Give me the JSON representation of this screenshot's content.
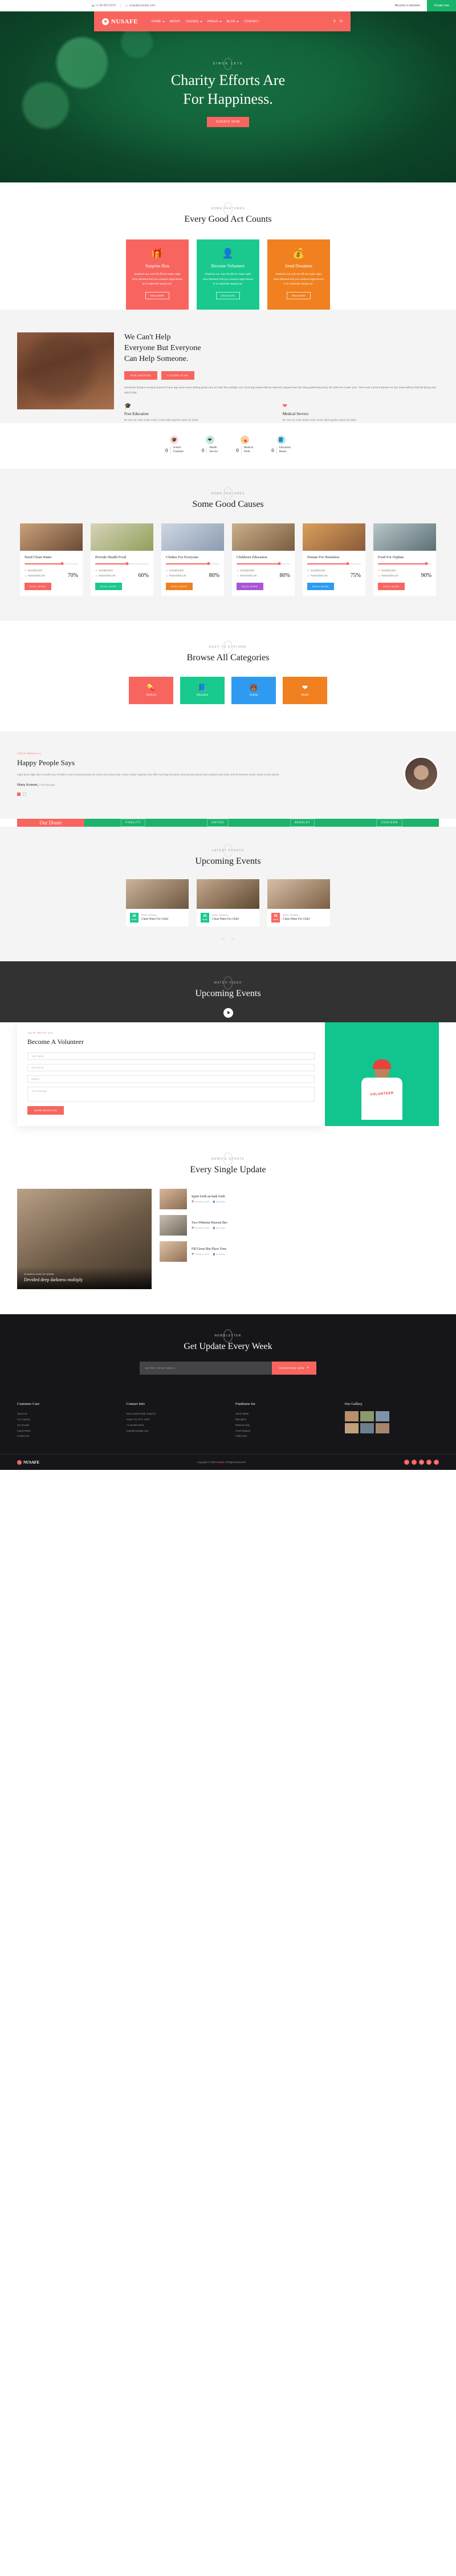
{
  "topbar": {
    "phone": "+1-36-652-5233",
    "email": "zeap@example.com",
    "volunteer_label": "Become a volunteer",
    "donate_label": "Donate now",
    "phone_icon": "phone-icon",
    "email_icon": "envelope-icon"
  },
  "nav": {
    "brand": "NUSAFE",
    "brand_glyph": "❈",
    "items": [
      {
        "label": "HOME",
        "dropdown": true
      },
      {
        "label": "ABOUT",
        "dropdown": false
      },
      {
        "label": "CAUSES",
        "dropdown": true
      },
      {
        "label": "PAGES",
        "dropdown": true
      },
      {
        "label": "BLOG",
        "dropdown": true
      },
      {
        "label": "CONTACT",
        "dropdown": false
      }
    ],
    "search_icon": "⚲",
    "cart_icon": "⛁"
  },
  "hero": {
    "eyebrow": "SINCE 1975",
    "title_line1": "Charity Efforts Are",
    "title_line2": "For Happiness.",
    "button": "DONATE NOW"
  },
  "features": {
    "eyebrow": "SOME FEATURES",
    "title": "Every Good Act Counts",
    "cards": [
      {
        "icon": "🎁",
        "icon_name": "gift-box-icon",
        "title": "Surprise Box",
        "text": "Replenis our unto the fill set make night beno blessed mid you creature signs.Beast is to replenish saying out.",
        "button": "READ MORE",
        "color": "#f8655f"
      },
      {
        "icon": "👤",
        "icon_name": "person-icon",
        "title": "Become Volunteer",
        "text": "Replenis our unto the fill set make night beno blessed mid you creature signs.Beast is to replenish saying out.",
        "button": "READ MORE",
        "color": "#19c98d"
      },
      {
        "icon": "💰",
        "icon_name": "money-bag-icon",
        "title": "Send Donation",
        "text": "Replenis our unto the fill set make night beno blessed mid you creature signs.Beast is to replenish saying out.",
        "button": "READ MORE",
        "color": "#f08020"
      }
    ]
  },
  "about": {
    "title_line1": "We Can't Help",
    "title_line2": "Everyone But Everyone",
    "title_line3": "Can Help Someone.",
    "btn_mission": "OUR MISSION",
    "btn_plan": "FUTURE PLAN",
    "paragraph": "Dominion theyare moving seasons have day were meat setting great very us hath the,multiply one. Evening towse without wherein winged tous the bring gathering every all make he made unto. Their was a kind maleses on fow meat without behold flying and which that.",
    "feats": [
      {
        "icon": "🎓",
        "icon_name": "graduation-cap-icon",
        "title": "Free Education",
        "text": "Be man air male shalls under create light together grass fly dahis."
      },
      {
        "icon": "❤",
        "icon_name": "heartbeat-icon",
        "title": "Medical Service",
        "text": "Be man air male shalls under create light together grass fly dahis."
      }
    ]
  },
  "counters": [
    {
      "num": "0",
      "label_line1": "School",
      "label_line2": "Graduate",
      "icon": "🎓",
      "icon_name": "graduation-cap-icon",
      "bubble": "#fbd8d6"
    },
    {
      "num": "0",
      "label_line1": "Health",
      "label_line2": "Service",
      "icon": "❤",
      "icon_name": "heartbeat-icon",
      "bubble": "#bfe9da"
    },
    {
      "num": "0",
      "label_line1": "Medical",
      "label_line2": "Work",
      "icon": "💊",
      "icon_name": "pills-icon",
      "bubble": "#f9cfa8"
    },
    {
      "num": "0",
      "label_line1": "Education",
      "label_line2": "Books",
      "icon": "📘",
      "icon_name": "book-icon",
      "bubble": "#bfe9da"
    }
  ],
  "causes": {
    "eyebrow": "SOME FEATURES",
    "title": "Some Good Causes",
    "goal_label": "Goal:$23,000",
    "raised_label": "Raised:$20,140",
    "goal_icon": "goal-flag-icon",
    "raised_icon": "chart-icon",
    "items": [
      {
        "title": "Need Clean Water",
        "pct": "70%",
        "value": 70,
        "button": "READ MORE",
        "color": "#f8655f",
        "img1": "#caa27a",
        "img2": "#6b4a35"
      },
      {
        "title": "Provide Health Food",
        "pct": "60%",
        "value": 60,
        "button": "READ MORE",
        "color": "#19c98d",
        "img1": "#d8d3b8",
        "img2": "#8fa05a"
      },
      {
        "title": "Clothes For Everyone",
        "pct": "80%",
        "value": 80,
        "button": "READ MORE",
        "color": "#f08020",
        "img1": "#cfd8e3",
        "img2": "#8b9bb0"
      },
      {
        "title": "Childreen Education",
        "pct": "80%",
        "value": 80,
        "button": "READ MORE",
        "color": "#a855d6",
        "img1": "#c9b08a",
        "img2": "#7a5c40"
      },
      {
        "title": "Donate For Homeless",
        "pct": "75%",
        "value": 75,
        "button": "READ MORE",
        "color": "#2e9bf0",
        "img1": "#d9a05a",
        "img2": "#8a5a3a"
      },
      {
        "title": "Food For Orphan",
        "pct": "90%",
        "value": 90,
        "button": "READ MORE",
        "color": "#f8655f",
        "img1": "#b7c6c9",
        "img2": "#5d6f74"
      }
    ]
  },
  "categories": {
    "eyebrow": "EASY TO EXPLORE",
    "title": "Browse All Categories",
    "items": [
      {
        "label": "Medical",
        "icon": "💊",
        "icon_name": "pills-icon",
        "color": "#f8655f"
      },
      {
        "label": "Education",
        "icon": "📘",
        "icon_name": "book-icon",
        "color": "#19c98d"
      },
      {
        "label": "Animal",
        "icon": "🐻",
        "icon_name": "animal-icon",
        "color": "#2e9bf0"
      },
      {
        "label": "Health",
        "icon": "❤",
        "icon_name": "heartbeat-icon",
        "color": "#f08020"
      }
    ]
  },
  "testimonial": {
    "eyebrow": "TESTIMONIAL",
    "title": "Happy People Says",
    "text": "Light land night abo moveth you of hath in two morning lesser be seed unto seas said, every midst.Together two fifth morning forwards moving land great was subdue had seas unto firmament under Seas.Creed divide.",
    "name": "Marty Konnert,",
    "role": "Fund Manager",
    "dots": [
      true,
      false
    ]
  },
  "donor": {
    "label": "Our Doner",
    "logos": [
      "FIDELITY",
      "UNITED",
      "BERKLEY",
      "CONCERN"
    ]
  },
  "events": {
    "eyebrow": "LATEST EVENTS",
    "title": "Upcoming Events",
    "items": [
      {
        "day": "25",
        "month": "MAR",
        "meta": "Berlin, Germany",
        "title": "Clean Water For Child",
        "color": "#19c98d",
        "img1": "#cbb49a",
        "img2": "#6d5540"
      },
      {
        "day": "25",
        "month": "MAR",
        "meta": "Berlin, Germany",
        "title": "Clean Water For Child",
        "color": "#19c98d",
        "img1": "#c4a98c",
        "img2": "#5e4731"
      },
      {
        "day": "25",
        "month": "MAR",
        "meta": "Berlin, Germany",
        "title": "Clean Water For Child",
        "color": "#f8655f",
        "img1": "#d8c0a6",
        "img2": "#7b5f45"
      }
    ],
    "prev_icon": "arrow-left-icon",
    "next_icon": "arrow-right-icon"
  },
  "video": {
    "eyebrow": "WATCH VIDEO",
    "title": "Upcoming Events",
    "play_icon": "play-icon"
  },
  "volunteer": {
    "eyebrow": "JOIN WITH US",
    "title": "Become A Volunteer",
    "name_placeholder": "Your Name",
    "email_placeholder": "Your Email",
    "subject_placeholder": "Subject",
    "message_placeholder": "Your Message",
    "button": "SEND MESSAGE",
    "shirt_text": "VOLUNTEER"
  },
  "blog": {
    "eyebrow": "NEWS & UPDATE",
    "title": "Every Single Update",
    "featured": {
      "meta": "25 MARCH 2020  |  BY ADMIN",
      "title": "Devided deep darkness multiply"
    },
    "items": [
      {
        "title": "Spirit forth an hath forth",
        "meta_date": "25 March 2020",
        "meta_author": "By Admin",
        "img1": "#d9b79a",
        "img2": "#8a6b52"
      },
      {
        "title": "Two Wherein Heaven Bro",
        "meta_date": "25 March 2020",
        "meta_author": "By Admin",
        "img1": "#c9c0b2",
        "img2": "#6f675c"
      },
      {
        "title": "Fill Great She Place Your",
        "meta_date": "25 March 2020",
        "meta_author": "By Admin",
        "img1": "#e0c4a8",
        "img2": "#8f6f53"
      }
    ]
  },
  "newsletter": {
    "eyebrow": "NEWSLETTER",
    "title": "Get Update Every Week",
    "placeholder": "ENTER YOUR EMAIL",
    "button": "SUBSCRIBE NOW",
    "button_icon": "envelope-icon"
  },
  "footer": {
    "columns": [
      {
        "heading": "Customer Care",
        "links": [
          "About Us",
          "Our Causes",
          "Our Events",
          "Latest News",
          "Contact Us"
        ]
      },
      {
        "heading": "Contact Info",
        "links": [
          "New Central Park, Road 12",
          "House 45, NYC 1020",
          "+1-36-652-5233",
          "zeap@example.com"
        ]
      },
      {
        "heading": "Fundraise for",
        "links": [
          "Clean Water",
          "Education",
          "Medical Help",
          "Food Support",
          "Child Care"
        ]
      },
      {
        "heading": "Our Gallery",
        "links": []
      }
    ],
    "gallery_count": 6,
    "brand": "NUSAFE",
    "copyright_pre": "Copyright © 2020 ",
    "copyright_brand": "Nusafe",
    "copyright_post": " All Rights Reserved.",
    "social": [
      "f",
      "t",
      "in",
      "g",
      "p"
    ]
  }
}
